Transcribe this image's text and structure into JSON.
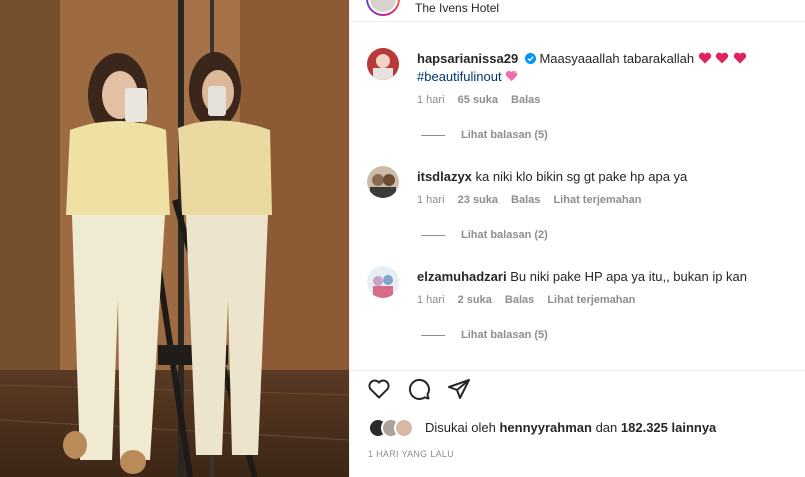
{
  "post": {
    "location": "The Ivens Hotel"
  },
  "comments": [
    {
      "username": "hapsarianissa29",
      "verified": true,
      "text": "Maasyaaallah tabarakallah",
      "hashtag": "#beautifulinout",
      "time": "1 hari",
      "likes": "65 suka",
      "reply_label": "Balas",
      "view_replies": "Lihat balasan (5)"
    },
    {
      "username": "itsdlazyx",
      "text": "ka niki klo bikin sg gt pake hp apa ya",
      "time": "1 hari",
      "likes": "23 suka",
      "reply_label": "Balas",
      "translate_label": "Lihat terjemahan",
      "view_replies": "Lihat balasan (2)"
    },
    {
      "username": "elzamuhadzari",
      "text": "Bu niki pake HP apa ya itu,, bukan ip kan",
      "time": "1 hari",
      "likes": "2 suka",
      "reply_label": "Balas",
      "translate_label": "Lihat terjemahan",
      "view_replies": "Lihat balasan (5)"
    }
  ],
  "actions": {
    "icons": [
      "heart-icon",
      "comment-icon",
      "share-icon"
    ]
  },
  "likes_summary": {
    "prefix": "Disukai oleh",
    "user": "hennyyrahman",
    "conjunction": "dan",
    "count": "182.325 lainnya"
  },
  "timestamp": "1 HARI YANG LALU",
  "colors": {
    "heart_red": "#e0245e",
    "link_blue": "#00376b",
    "muted": "#8e8e8e",
    "verified_blue": "#0095f6"
  }
}
